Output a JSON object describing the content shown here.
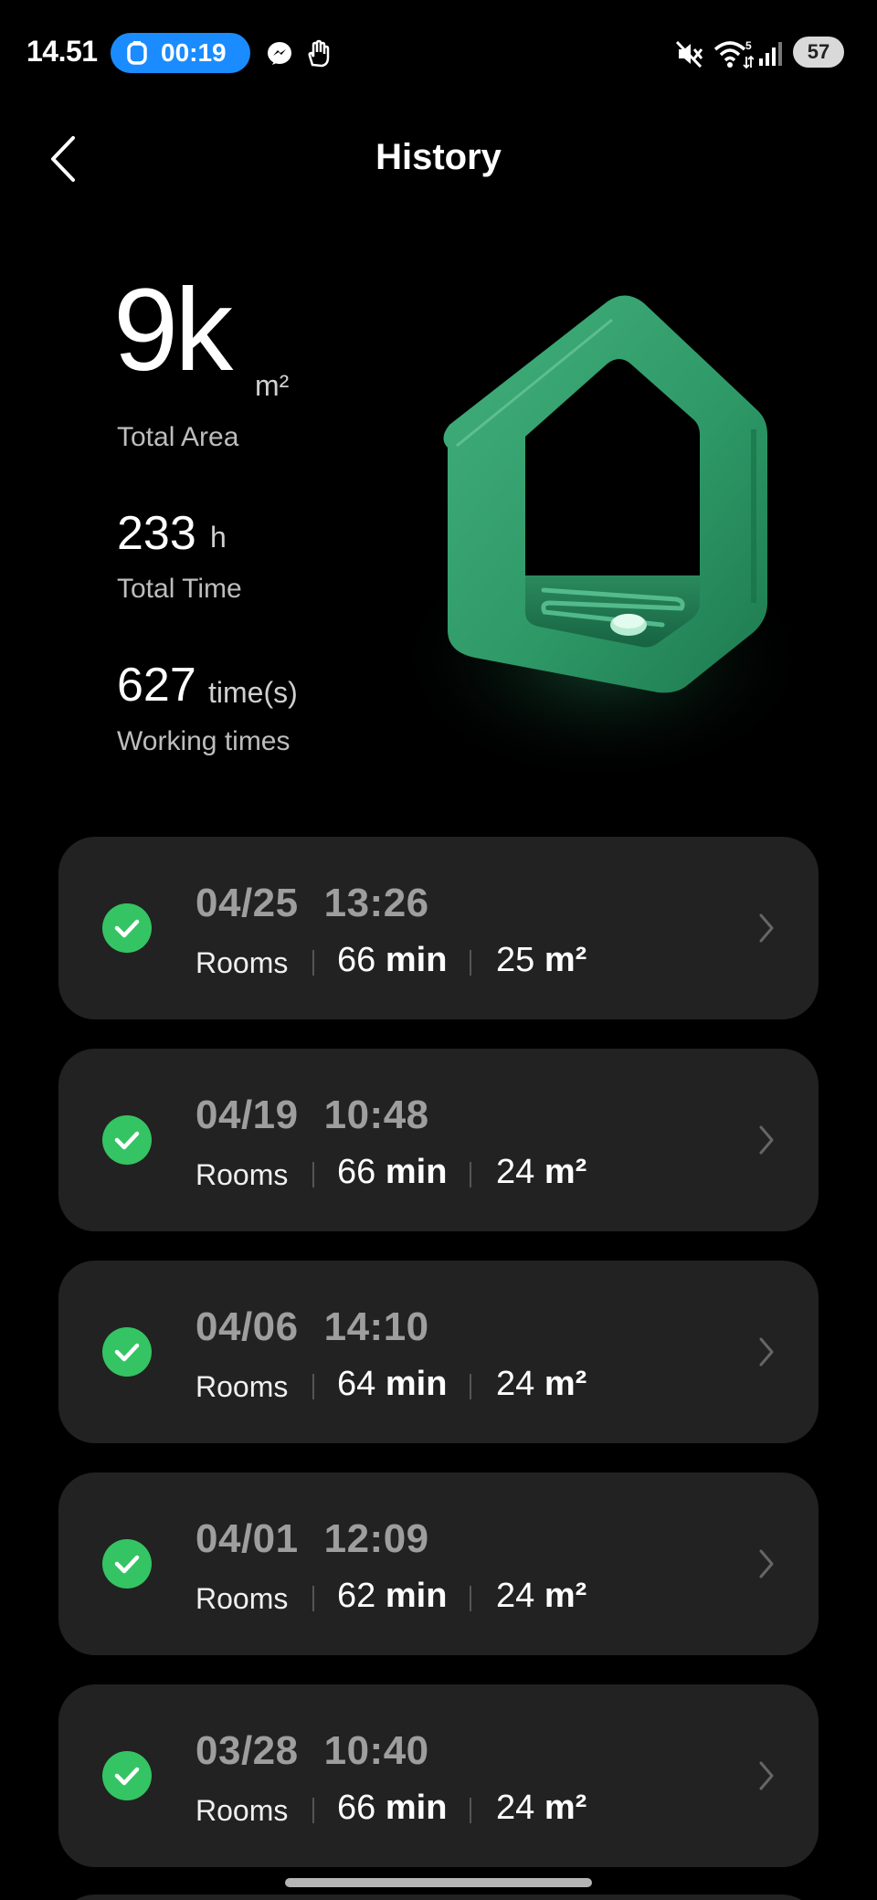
{
  "status_bar": {
    "time": "14.51",
    "timer": "00:19",
    "battery": "57",
    "icons": [
      "messenger-icon",
      "hand-gesture-icon",
      "mute-icon",
      "wifi-icon",
      "signal-icon"
    ]
  },
  "header": {
    "title": "History"
  },
  "stats": {
    "area_value": "9k",
    "area_unit": "m²",
    "area_label": "Total Area",
    "time_value": "233",
    "time_unit": "h",
    "time_label": "Total Time",
    "count_value": "627",
    "count_unit": "time(s)",
    "count_label": "Working times"
  },
  "records": [
    {
      "date": "04/25",
      "time": "13:26",
      "mode": "Rooms",
      "duration": "66",
      "duration_unit": "min",
      "area": "25",
      "area_unit": "m²"
    },
    {
      "date": "04/19",
      "time": "10:48",
      "mode": "Rooms",
      "duration": "66",
      "duration_unit": "min",
      "area": "24",
      "area_unit": "m²"
    },
    {
      "date": "04/06",
      "time": "14:10",
      "mode": "Rooms",
      "duration": "64",
      "duration_unit": "min",
      "area": "24",
      "area_unit": "m²"
    },
    {
      "date": "04/01",
      "time": "12:09",
      "mode": "Rooms",
      "duration": "62",
      "duration_unit": "min",
      "area": "24",
      "area_unit": "m²"
    },
    {
      "date": "03/28",
      "time": "10:40",
      "mode": "Rooms",
      "duration": "66",
      "duration_unit": "min",
      "area": "24",
      "area_unit": "m²"
    }
  ],
  "colors": {
    "background": "#000000",
    "card": "#222222",
    "accent_green": "#35c463",
    "timer_blue": "#1a8cff",
    "illustration_green": "#2f9a68"
  }
}
